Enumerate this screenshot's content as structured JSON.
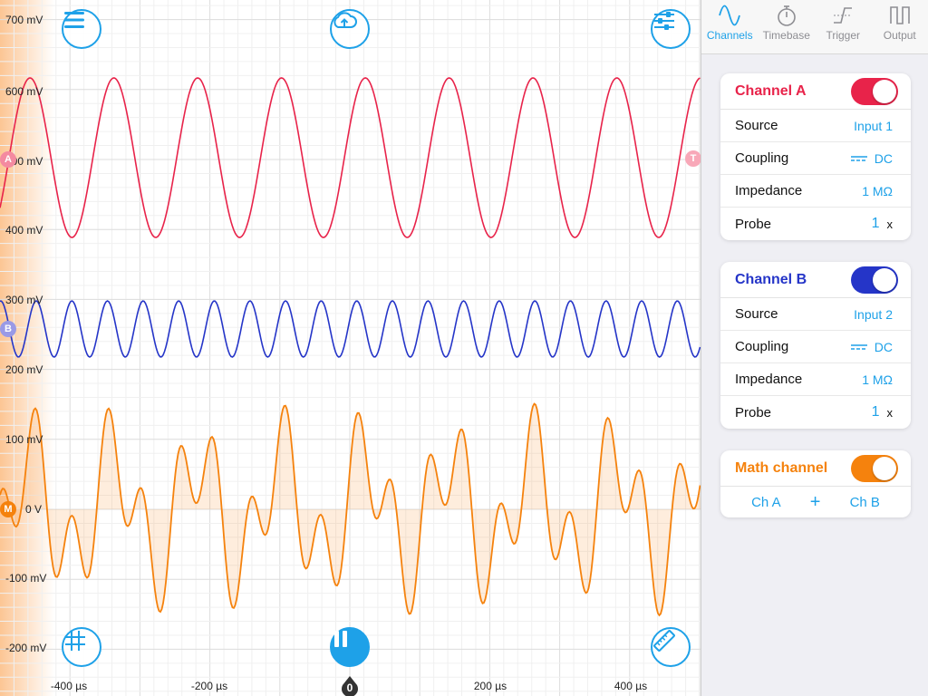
{
  "scope": {
    "y_labels": [
      "700 mV",
      "600 mV",
      "500 mV",
      "400 mV",
      "300 mV",
      "200 mV",
      "100 mV",
      "0 V",
      "-100 mV",
      "-200 mV"
    ],
    "x_labels": [
      "-400 µs",
      "-200 µs",
      "200 µs",
      "400 µs"
    ],
    "zero_marker": "0",
    "markers": {
      "a": "A",
      "b": "B",
      "m": "M",
      "t": "T"
    },
    "colors": {
      "channel_a": "#e8234a",
      "channel_b": "#2535c8",
      "math": "#f5820d",
      "accent": "#1ea1e8"
    },
    "icons": {
      "menu": "menu-icon",
      "upload": "cloud-upload-icon",
      "settings": "sliders-icon",
      "grid": "grid-icon",
      "pause": "pause-icon",
      "ruler": "ruler-icon"
    }
  },
  "tabs": [
    {
      "label": "Channels",
      "icon": "sine-wave-icon",
      "active": true
    },
    {
      "label": "Timebase",
      "icon": "stopwatch-icon",
      "active": false
    },
    {
      "label": "Trigger",
      "icon": "trigger-edge-icon",
      "active": false
    },
    {
      "label": "Output",
      "icon": "square-wave-icon",
      "active": false
    }
  ],
  "channel_a": {
    "title": "Channel A",
    "enabled": true,
    "source_label": "Source",
    "source_value": "Input 1",
    "coupling_label": "Coupling",
    "coupling_value": "DC",
    "impedance_label": "Impedance",
    "impedance_value": "1 MΩ",
    "probe_label": "Probe",
    "probe_value": "1",
    "probe_unit": "x"
  },
  "channel_b": {
    "title": "Channel B",
    "enabled": true,
    "source_label": "Source",
    "source_value": "Input 2",
    "coupling_label": "Coupling",
    "coupling_value": "DC",
    "impedance_label": "Impedance",
    "impedance_value": "1 MΩ",
    "probe_label": "Probe",
    "probe_value": "1",
    "probe_unit": "x"
  },
  "math": {
    "title": "Math channel",
    "enabled": true,
    "operand_a": "Ch A",
    "operator": "+",
    "operand_b": "Ch B"
  }
}
